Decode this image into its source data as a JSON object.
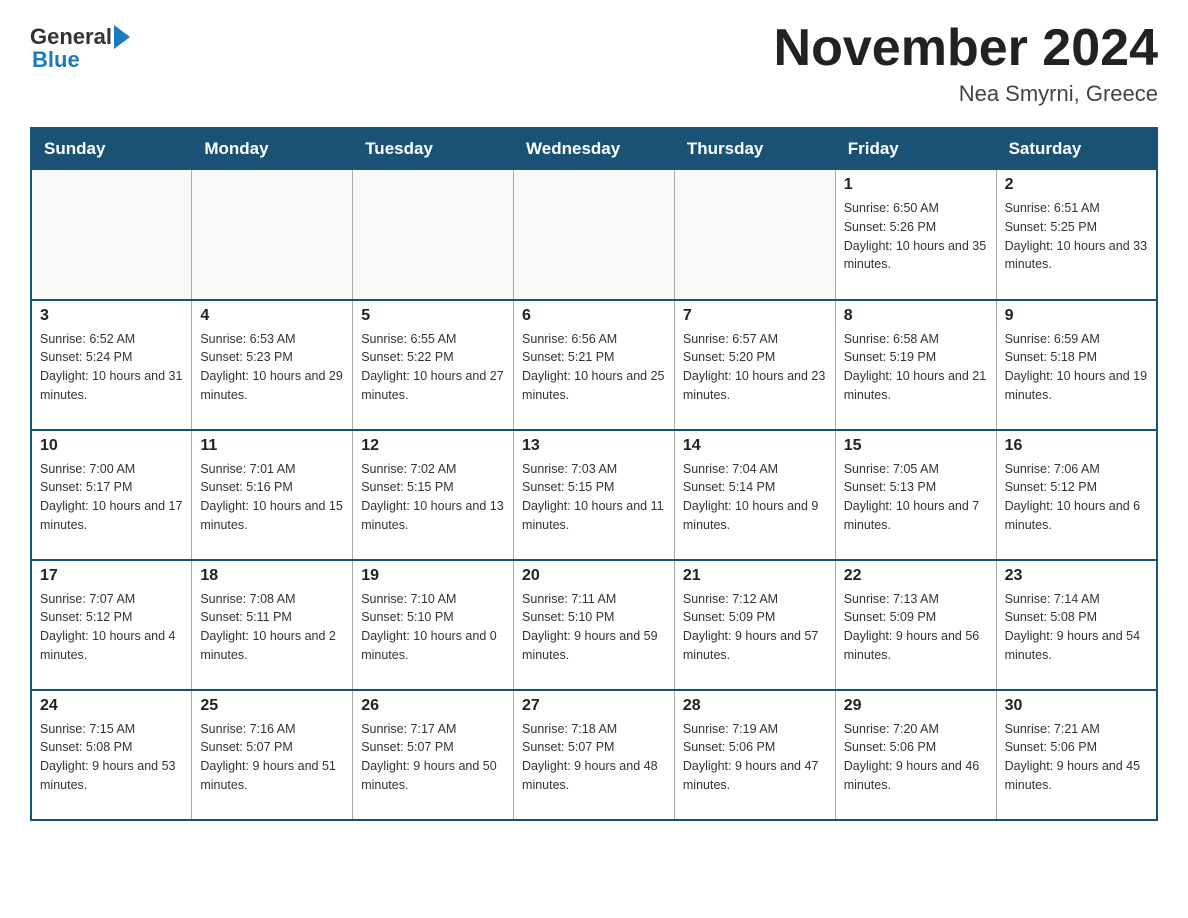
{
  "header": {
    "logo_general": "General",
    "logo_blue": "Blue",
    "title": "November 2024",
    "subtitle": "Nea Smyrni, Greece"
  },
  "days_of_week": [
    "Sunday",
    "Monday",
    "Tuesday",
    "Wednesday",
    "Thursday",
    "Friday",
    "Saturday"
  ],
  "weeks": [
    [
      {
        "day": "",
        "sunrise": "",
        "sunset": "",
        "daylight": ""
      },
      {
        "day": "",
        "sunrise": "",
        "sunset": "",
        "daylight": ""
      },
      {
        "day": "",
        "sunrise": "",
        "sunset": "",
        "daylight": ""
      },
      {
        "day": "",
        "sunrise": "",
        "sunset": "",
        "daylight": ""
      },
      {
        "day": "",
        "sunrise": "",
        "sunset": "",
        "daylight": ""
      },
      {
        "day": "1",
        "sunrise": "Sunrise: 6:50 AM",
        "sunset": "Sunset: 5:26 PM",
        "daylight": "Daylight: 10 hours and 35 minutes."
      },
      {
        "day": "2",
        "sunrise": "Sunrise: 6:51 AM",
        "sunset": "Sunset: 5:25 PM",
        "daylight": "Daylight: 10 hours and 33 minutes."
      }
    ],
    [
      {
        "day": "3",
        "sunrise": "Sunrise: 6:52 AM",
        "sunset": "Sunset: 5:24 PM",
        "daylight": "Daylight: 10 hours and 31 minutes."
      },
      {
        "day": "4",
        "sunrise": "Sunrise: 6:53 AM",
        "sunset": "Sunset: 5:23 PM",
        "daylight": "Daylight: 10 hours and 29 minutes."
      },
      {
        "day": "5",
        "sunrise": "Sunrise: 6:55 AM",
        "sunset": "Sunset: 5:22 PM",
        "daylight": "Daylight: 10 hours and 27 minutes."
      },
      {
        "day": "6",
        "sunrise": "Sunrise: 6:56 AM",
        "sunset": "Sunset: 5:21 PM",
        "daylight": "Daylight: 10 hours and 25 minutes."
      },
      {
        "day": "7",
        "sunrise": "Sunrise: 6:57 AM",
        "sunset": "Sunset: 5:20 PM",
        "daylight": "Daylight: 10 hours and 23 minutes."
      },
      {
        "day": "8",
        "sunrise": "Sunrise: 6:58 AM",
        "sunset": "Sunset: 5:19 PM",
        "daylight": "Daylight: 10 hours and 21 minutes."
      },
      {
        "day": "9",
        "sunrise": "Sunrise: 6:59 AM",
        "sunset": "Sunset: 5:18 PM",
        "daylight": "Daylight: 10 hours and 19 minutes."
      }
    ],
    [
      {
        "day": "10",
        "sunrise": "Sunrise: 7:00 AM",
        "sunset": "Sunset: 5:17 PM",
        "daylight": "Daylight: 10 hours and 17 minutes."
      },
      {
        "day": "11",
        "sunrise": "Sunrise: 7:01 AM",
        "sunset": "Sunset: 5:16 PM",
        "daylight": "Daylight: 10 hours and 15 minutes."
      },
      {
        "day": "12",
        "sunrise": "Sunrise: 7:02 AM",
        "sunset": "Sunset: 5:15 PM",
        "daylight": "Daylight: 10 hours and 13 minutes."
      },
      {
        "day": "13",
        "sunrise": "Sunrise: 7:03 AM",
        "sunset": "Sunset: 5:15 PM",
        "daylight": "Daylight: 10 hours and 11 minutes."
      },
      {
        "day": "14",
        "sunrise": "Sunrise: 7:04 AM",
        "sunset": "Sunset: 5:14 PM",
        "daylight": "Daylight: 10 hours and 9 minutes."
      },
      {
        "day": "15",
        "sunrise": "Sunrise: 7:05 AM",
        "sunset": "Sunset: 5:13 PM",
        "daylight": "Daylight: 10 hours and 7 minutes."
      },
      {
        "day": "16",
        "sunrise": "Sunrise: 7:06 AM",
        "sunset": "Sunset: 5:12 PM",
        "daylight": "Daylight: 10 hours and 6 minutes."
      }
    ],
    [
      {
        "day": "17",
        "sunrise": "Sunrise: 7:07 AM",
        "sunset": "Sunset: 5:12 PM",
        "daylight": "Daylight: 10 hours and 4 minutes."
      },
      {
        "day": "18",
        "sunrise": "Sunrise: 7:08 AM",
        "sunset": "Sunset: 5:11 PM",
        "daylight": "Daylight: 10 hours and 2 minutes."
      },
      {
        "day": "19",
        "sunrise": "Sunrise: 7:10 AM",
        "sunset": "Sunset: 5:10 PM",
        "daylight": "Daylight: 10 hours and 0 minutes."
      },
      {
        "day": "20",
        "sunrise": "Sunrise: 7:11 AM",
        "sunset": "Sunset: 5:10 PM",
        "daylight": "Daylight: 9 hours and 59 minutes."
      },
      {
        "day": "21",
        "sunrise": "Sunrise: 7:12 AM",
        "sunset": "Sunset: 5:09 PM",
        "daylight": "Daylight: 9 hours and 57 minutes."
      },
      {
        "day": "22",
        "sunrise": "Sunrise: 7:13 AM",
        "sunset": "Sunset: 5:09 PM",
        "daylight": "Daylight: 9 hours and 56 minutes."
      },
      {
        "day": "23",
        "sunrise": "Sunrise: 7:14 AM",
        "sunset": "Sunset: 5:08 PM",
        "daylight": "Daylight: 9 hours and 54 minutes."
      }
    ],
    [
      {
        "day": "24",
        "sunrise": "Sunrise: 7:15 AM",
        "sunset": "Sunset: 5:08 PM",
        "daylight": "Daylight: 9 hours and 53 minutes."
      },
      {
        "day": "25",
        "sunrise": "Sunrise: 7:16 AM",
        "sunset": "Sunset: 5:07 PM",
        "daylight": "Daylight: 9 hours and 51 minutes."
      },
      {
        "day": "26",
        "sunrise": "Sunrise: 7:17 AM",
        "sunset": "Sunset: 5:07 PM",
        "daylight": "Daylight: 9 hours and 50 minutes."
      },
      {
        "day": "27",
        "sunrise": "Sunrise: 7:18 AM",
        "sunset": "Sunset: 5:07 PM",
        "daylight": "Daylight: 9 hours and 48 minutes."
      },
      {
        "day": "28",
        "sunrise": "Sunrise: 7:19 AM",
        "sunset": "Sunset: 5:06 PM",
        "daylight": "Daylight: 9 hours and 47 minutes."
      },
      {
        "day": "29",
        "sunrise": "Sunrise: 7:20 AM",
        "sunset": "Sunset: 5:06 PM",
        "daylight": "Daylight: 9 hours and 46 minutes."
      },
      {
        "day": "30",
        "sunrise": "Sunrise: 7:21 AM",
        "sunset": "Sunset: 5:06 PM",
        "daylight": "Daylight: 9 hours and 45 minutes."
      }
    ]
  ]
}
